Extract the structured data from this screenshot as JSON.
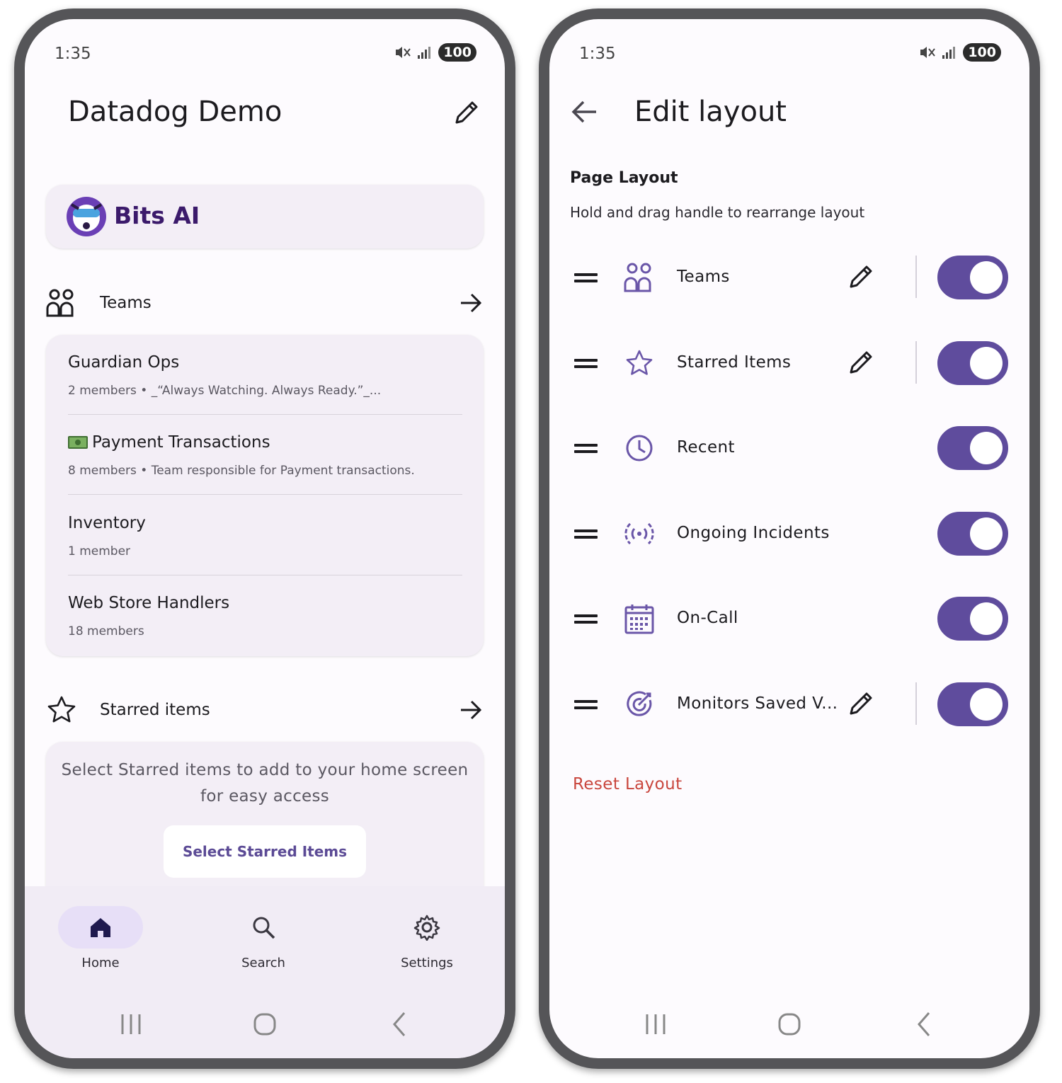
{
  "status_bar": {
    "time": "1:35",
    "battery": "100"
  },
  "home": {
    "title": "Datadog Demo",
    "bits_ai": "Bits AI",
    "teams_section": {
      "label": "Teams",
      "items": [
        {
          "name": "Guardian Ops",
          "desc": "2 members • _“Always Watching. Always Ready.”_..."
        },
        {
          "name": "Payment Transactions",
          "desc": "8 members • Team responsible for Payment transactions."
        },
        {
          "name": "Inventory",
          "desc": "1 member"
        },
        {
          "name": "Web Store Handlers",
          "desc": "18 members"
        }
      ]
    },
    "starred_section": {
      "label": "Starred items",
      "empty_message": "Select Starred items to add to your home screen for easy access",
      "button": "Select Starred Items"
    },
    "nav": [
      {
        "label": "Home",
        "icon": "home-icon",
        "active": true
      },
      {
        "label": "Search",
        "icon": "search-icon",
        "active": false
      },
      {
        "label": "Settings",
        "icon": "gear-icon",
        "active": false
      }
    ]
  },
  "edit_layout": {
    "title": "Edit layout",
    "section_title": "Page Layout",
    "instruction": "Hold and drag handle to rearrange layout",
    "rows": [
      {
        "label": "Teams",
        "icon": "teams-icon",
        "editable": true,
        "enabled": true
      },
      {
        "label": "Starred Items",
        "icon": "star-icon",
        "editable": true,
        "enabled": true
      },
      {
        "label": "Recent",
        "icon": "clock-icon",
        "editable": false,
        "enabled": true
      },
      {
        "label": "Ongoing Incidents",
        "icon": "incident-signal-icon",
        "editable": false,
        "enabled": true
      },
      {
        "label": "On-Call",
        "icon": "calendar-icon",
        "editable": false,
        "enabled": true
      },
      {
        "label": "Monitors Saved V...",
        "icon": "monitor-target-icon",
        "editable": true,
        "enabled": true
      }
    ],
    "reset": "Reset Layout"
  },
  "colors": {
    "accent": "#5f4c9d",
    "icon_purple": "#6a56a8",
    "card_bg": "#f3eef6",
    "reset_red": "#c9463d",
    "bits_purple": "#3b1a6b"
  }
}
